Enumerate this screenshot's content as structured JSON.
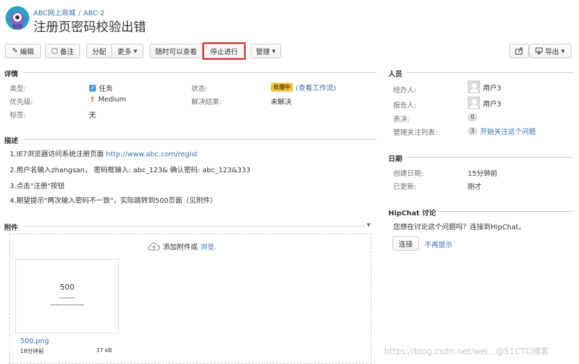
{
  "breadcrumb": {
    "project": "ABC网上商城",
    "separator": "/",
    "issue_key": "ABC-2"
  },
  "title": "注册页密码校验出错",
  "toolbar": {
    "edit": "编辑",
    "comment": "备注",
    "assign": "分配",
    "more": "更多",
    "view_anytime": "随时可以查看",
    "stop_progress": "停止进行",
    "manage": "管理",
    "export": "导出"
  },
  "details": {
    "heading": "详情",
    "type_label": "类型:",
    "type_value": "任务",
    "priority_label": "优先级:",
    "priority_value": "Medium",
    "labels_label": "标签:",
    "labels_value": "无",
    "status_label": "状态:",
    "status_value": "处理中",
    "workflow_link": "(查看工作流)",
    "resolution_label": "解决结果:",
    "resolution_value": "未解决"
  },
  "description": {
    "heading": "描述",
    "line1_text": "1.IE7浏览器访问系统注册页面",
    "line1_url": "http://www.abc.com/regist",
    "line2": "2.用户名输入zhangsan， 密码框输入: abc_123& 确认密码: abc_123&333",
    "line3": "3.点击\"注册\"按钮",
    "line4": "4.期望提示\"两次输入密码不一致\"，实际跳转到500页面（见附件）"
  },
  "attachments": {
    "heading": "附件",
    "add_text": "添加附件或",
    "browse": "浏览.",
    "file_name": "500.png",
    "file_time": "18分钟前",
    "file_size": "37 kB",
    "thumb_text": "500"
  },
  "people": {
    "heading": "人员",
    "assignee_label": "经办人:",
    "assignee_value": "用户3",
    "reporter_label": "报告人:",
    "reporter_value": "用户3",
    "votes_label": "表决:",
    "votes_value": "0",
    "watchers_label": "管理关注列表:",
    "watchers_value": "3",
    "watch_link": "开始关注这个问题"
  },
  "dates": {
    "heading": "日期",
    "created_label": "创建日期:",
    "created_value": "15分钟前",
    "updated_label": "已更新:",
    "updated_value": "刚才"
  },
  "hipchat": {
    "heading": "HipChat 讨论",
    "prompt": "您想在讨论这个问题吗？连接到HipChat。",
    "connect": "连接",
    "dismiss": "不再提示"
  },
  "watermark": "https://blog.csdn.net/wei...@51CTO博客"
}
